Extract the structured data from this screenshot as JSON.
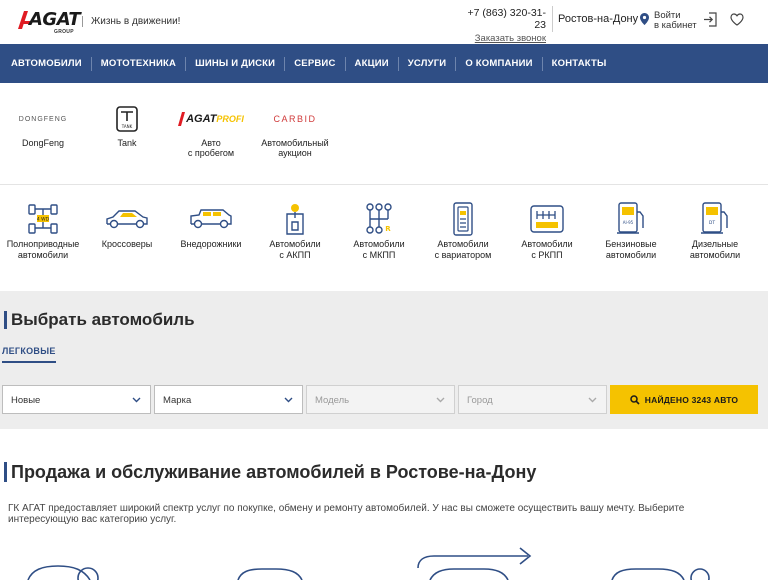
{
  "header": {
    "logo_word": "AGAT",
    "logo_group": "GROUP",
    "slogan": "Жизнь в движении!",
    "phone": "+7 (863) 320-31-23",
    "callback": "Заказать звонок",
    "city": "Ростов-на-Дону",
    "login_line1": "Войти",
    "login_line2": "в кабинет",
    "accent": "#2f4e85",
    "logo_red": "#e01b22"
  },
  "nav": {
    "items": [
      "АВТОМОБИЛИ",
      "МОТОТЕХНИКА",
      "ШИНЫ И ДИСКИ",
      "СЕРВИС",
      "АКЦИИ",
      "УСЛУГИ",
      "О КОМПАНИИ",
      "КОНТАКТЫ"
    ]
  },
  "brands": [
    {
      "label_line1": "DongFeng",
      "label_line2": "",
      "logo_text": "DONGFENG",
      "icon": "dongfeng-logo"
    },
    {
      "label_line1": "Tank",
      "label_line2": "",
      "logo_text": "TANK",
      "icon": "tank-logo"
    },
    {
      "label_line1": "Авто",
      "label_line2": "с пробегом",
      "logo_text": "AGAT",
      "logo_text2": "PROFI",
      "icon": "agat-profi-logo"
    },
    {
      "label_line1": "Автомобильный",
      "label_line2": "аукцион",
      "logo_text": "CARBID",
      "icon": "carbid-logo"
    }
  ],
  "categories": [
    {
      "line1": "Полноприводные",
      "line2": "автомобили",
      "icon": "4wd-icon",
      "badge": "4 WD"
    },
    {
      "line1": "Кроссоверы",
      "line2": "",
      "icon": "crossover-icon"
    },
    {
      "line1": "Внедорожники",
      "line2": "",
      "icon": "suv-icon"
    },
    {
      "line1": "Автомобили",
      "line2": "с АКПП",
      "icon": "automatic-gearbox-icon"
    },
    {
      "line1": "Автомобили",
      "line2": "с МКПП",
      "icon": "manual-gearbox-icon",
      "badge": "R"
    },
    {
      "line1": "Автомобили",
      "line2": "с вариатором",
      "icon": "cvt-icon"
    },
    {
      "line1": "Автомобили",
      "line2": "с РКПП",
      "icon": "robot-gearbox-icon"
    },
    {
      "line1": "Бензиновые",
      "line2": "автомобили",
      "icon": "petrol-pump-icon",
      "badge": "AI-95"
    },
    {
      "line1": "Дизельные",
      "line2": "автомобили",
      "icon": "diesel-pump-icon",
      "badge": "DT"
    }
  ],
  "search": {
    "title": "Выбрать автомобиль",
    "tab": "ЛЕГКОВЫЕ",
    "fields": [
      {
        "value": "Новые",
        "disabled": false
      },
      {
        "value": "Марка",
        "disabled": false
      },
      {
        "value": "Модель",
        "disabled": true
      },
      {
        "value": "Город",
        "disabled": true
      }
    ],
    "found_button": "НАЙДЕНО 3243 АВТО",
    "button_color": "#f5c200"
  },
  "content": {
    "title": "Продажа и обслуживание автомобилей в Ростове-на-Дону",
    "text": "ГК АГАТ предоставляет широкий спектр услуг по покупке, обмену и ремонту автомобилей. У нас вы сможете осуществить вашу мечту. Выберите интересующую вас категорию услуг."
  }
}
